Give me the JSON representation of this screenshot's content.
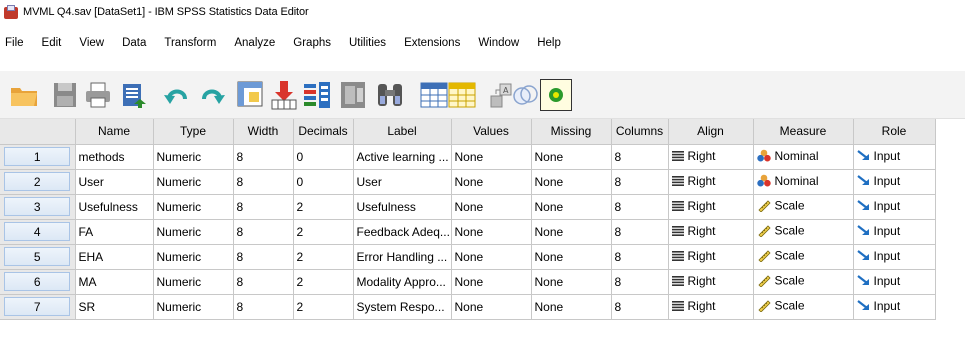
{
  "window": {
    "title": "MVML Q4.sav [DataSet1] - IBM SPSS Statistics Data Editor"
  },
  "menu": [
    "File",
    "Edit",
    "View",
    "Data",
    "Transform",
    "Analyze",
    "Graphs",
    "Utilities",
    "Extensions",
    "Window",
    "Help"
  ],
  "toolbar": [
    {
      "icon": "open-folder-icon"
    },
    {
      "icon": "save-icon"
    },
    {
      "icon": "print-icon"
    },
    {
      "icon": "recall-dialog-icon"
    },
    {
      "icon": "undo-icon"
    },
    {
      "icon": "redo-icon"
    },
    {
      "icon": "go-to-case-icon"
    },
    {
      "icon": "go-to-variable-icon"
    },
    {
      "icon": "variables-icon"
    },
    {
      "icon": "run-descriptives-icon"
    },
    {
      "icon": "find-icon"
    },
    {
      "icon": "insert-cases-icon"
    },
    {
      "icon": "insert-variable-icon"
    },
    {
      "icon": "split-file-icon"
    },
    {
      "icon": "select-cases-icon"
    },
    {
      "icon": "value-labels-icon"
    }
  ],
  "columns": [
    "Name",
    "Type",
    "Width",
    "Decimals",
    "Label",
    "Values",
    "Missing",
    "Columns",
    "Align",
    "Measure",
    "Role"
  ],
  "colors": {
    "header_bg": "#e8e8e8",
    "grid_line": "#c8c8c8",
    "row_btn": "#a9c4e6"
  },
  "rows": [
    {
      "n": "1",
      "name": "methods",
      "type": "Numeric",
      "width": "8",
      "decimals": "0",
      "label": "Active learning ...",
      "values": "None",
      "missing": "None",
      "columns": "8",
      "align": "Right",
      "measure": "Nominal",
      "measure_icon": "nominal-icon",
      "role": "Input"
    },
    {
      "n": "2",
      "name": "User",
      "type": "Numeric",
      "width": "8",
      "decimals": "0",
      "label": "User",
      "values": "None",
      "missing": "None",
      "columns": "8",
      "align": "Right",
      "measure": "Nominal",
      "measure_icon": "nominal-icon",
      "role": "Input"
    },
    {
      "n": "3",
      "name": "Usefulness",
      "type": "Numeric",
      "width": "8",
      "decimals": "2",
      "label": "Usefulness",
      "values": "None",
      "missing": "None",
      "columns": "8",
      "align": "Right",
      "measure": "Scale",
      "measure_icon": "scale-icon",
      "role": "Input"
    },
    {
      "n": "4",
      "name": "FA",
      "type": "Numeric",
      "width": "8",
      "decimals": "2",
      "label": "Feedback Adeq...",
      "values": "None",
      "missing": "None",
      "columns": "8",
      "align": "Right",
      "measure": "Scale",
      "measure_icon": "scale-icon",
      "role": "Input"
    },
    {
      "n": "5",
      "name": "EHA",
      "type": "Numeric",
      "width": "8",
      "decimals": "2",
      "label": "Error Handling ...",
      "values": "None",
      "missing": "None",
      "columns": "8",
      "align": "Right",
      "measure": "Scale",
      "measure_icon": "scale-icon",
      "role": "Input"
    },
    {
      "n": "6",
      "name": "MA",
      "type": "Numeric",
      "width": "8",
      "decimals": "2",
      "label": "Modality Appro...",
      "values": "None",
      "missing": "None",
      "columns": "8",
      "align": "Right",
      "measure": "Scale",
      "measure_icon": "scale-icon",
      "role": "Input"
    },
    {
      "n": "7",
      "name": "SR",
      "type": "Numeric",
      "width": "8",
      "decimals": "2",
      "label": "System Respo...",
      "values": "None",
      "missing": "None",
      "columns": "8",
      "align": "Right",
      "measure": "Scale",
      "measure_icon": "scale-icon",
      "role": "Input"
    }
  ]
}
